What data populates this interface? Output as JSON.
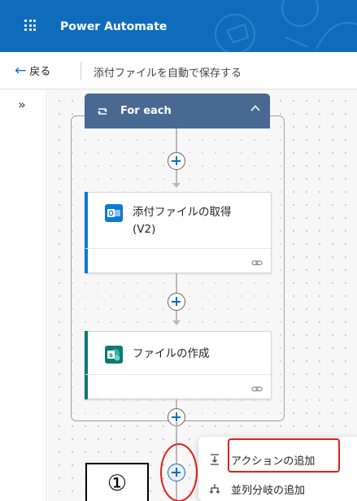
{
  "app": {
    "title": "Power Automate"
  },
  "commandbar": {
    "back_label": "戻る",
    "flow_name": "添付ファイルを自動で保存する"
  },
  "foreach": {
    "label": "For each"
  },
  "cards": [
    {
      "title": "添付ファイルの取得 (V2)",
      "app_icon": "outlook-icon",
      "accent": "#0f78d4"
    },
    {
      "title": "ファイルの作成",
      "app_icon": "sharepoint-icon",
      "accent": "#0d7a70"
    }
  ],
  "context_menu": {
    "items": [
      {
        "label": "アクションの追加"
      },
      {
        "label": "並列分岐の追加"
      }
    ]
  },
  "annotation": {
    "marker": "①"
  },
  "colors": {
    "brand": "#0f6cbd",
    "foreach_header": "#486991",
    "highlight": "#e0201b"
  }
}
